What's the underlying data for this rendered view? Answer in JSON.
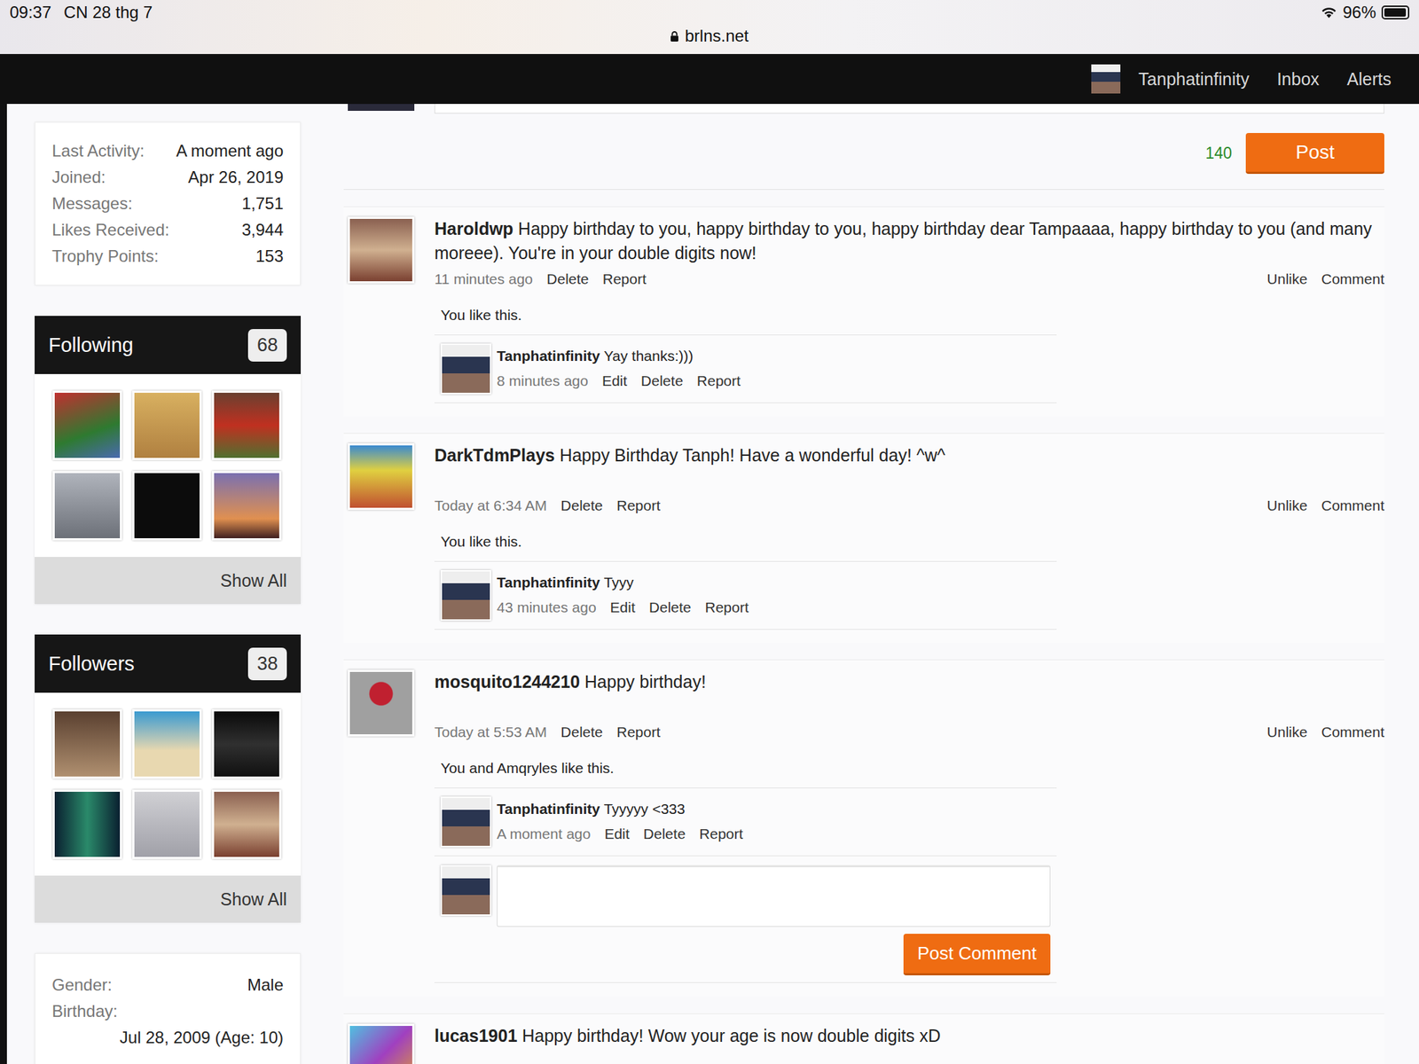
{
  "status_bar": {
    "time": "09:37",
    "date": "CN 28 thg 7",
    "url": "brlns.net",
    "battery": "96%",
    "battery_level": 0.96
  },
  "nav": {
    "username": "Tanphatinfinity",
    "links": [
      "Inbox",
      "Alerts"
    ]
  },
  "sidebar": {
    "stats": [
      {
        "label": "Last Activity:",
        "value": "A moment ago"
      },
      {
        "label": "Joined:",
        "value": "Apr 26, 2019"
      },
      {
        "label": "Messages:",
        "value": "1,751"
      },
      {
        "label": "Likes Received:",
        "value": "3,944"
      },
      {
        "label": "Trophy Points:",
        "value": "153"
      }
    ],
    "following": {
      "title": "Following",
      "count": "68",
      "show_all": "Show All",
      "thumbs": 6
    },
    "followers": {
      "title": "Followers",
      "count": "38",
      "show_all": "Show All",
      "thumbs": 6
    },
    "info": [
      {
        "label": "Gender:",
        "value": "Male",
        "kind": "inline"
      },
      {
        "label": "Birthday:",
        "value": "Jul 28, 2009 (Age: 10)",
        "kind": "stacked"
      }
    ]
  },
  "composer": {
    "counter": "140",
    "button": "Post"
  },
  "posts": [
    {
      "author": "Haroldwp",
      "message": "Happy birthday to you, happy birthday to you, happy birthday dear Tampaaaa, happy birthday to you (and many moreee). You're in your double digits now!",
      "time": "11 minutes ago",
      "actions": [
        "Delete",
        "Report"
      ],
      "right_actions": [
        "Unlike",
        "Comment"
      ],
      "likes": "You like this.",
      "comments": [
        {
          "author": "Tanphatinfinity",
          "text": "Yay thanks:)))",
          "time": "8 minutes ago",
          "actions": [
            "Edit",
            "Delete",
            "Report"
          ]
        }
      ],
      "comment_form": {
        "open": false,
        "button": ""
      }
    },
    {
      "author": "DarkTdmPlays",
      "message": "Happy Birthday Tanph! Have a wonderful day! ^w^",
      "time": "Today at 6:34 AM",
      "actions": [
        "Delete",
        "Report"
      ],
      "right_actions": [
        "Unlike",
        "Comment"
      ],
      "likes": "You like this.",
      "comments": [
        {
          "author": "Tanphatinfinity",
          "text": "Tyyy",
          "time": "43 minutes ago",
          "actions": [
            "Edit",
            "Delete",
            "Report"
          ]
        }
      ],
      "comment_form": {
        "open": false,
        "button": ""
      }
    },
    {
      "author": "mosquito1244210",
      "message": "Happy birthday!",
      "time": "Today at 5:53 AM",
      "actions": [
        "Delete",
        "Report"
      ],
      "right_actions": [
        "Unlike",
        "Comment"
      ],
      "likes": "You and Amqryles like this.",
      "comments": [
        {
          "author": "Tanphatinfinity",
          "text": "Tyyyyy <333",
          "time": "A moment ago",
          "actions": [
            "Edit",
            "Delete",
            "Report"
          ]
        }
      ],
      "comment_form": {
        "open": true,
        "button": "Post Comment"
      }
    },
    {
      "author": "lucas1901",
      "message": "Happy birthday! Wow your age is now double digits xD",
      "time": "",
      "actions": [],
      "right_actions": [],
      "likes": "",
      "comments": [],
      "comment_form": {
        "open": false,
        "button": ""
      }
    }
  ]
}
